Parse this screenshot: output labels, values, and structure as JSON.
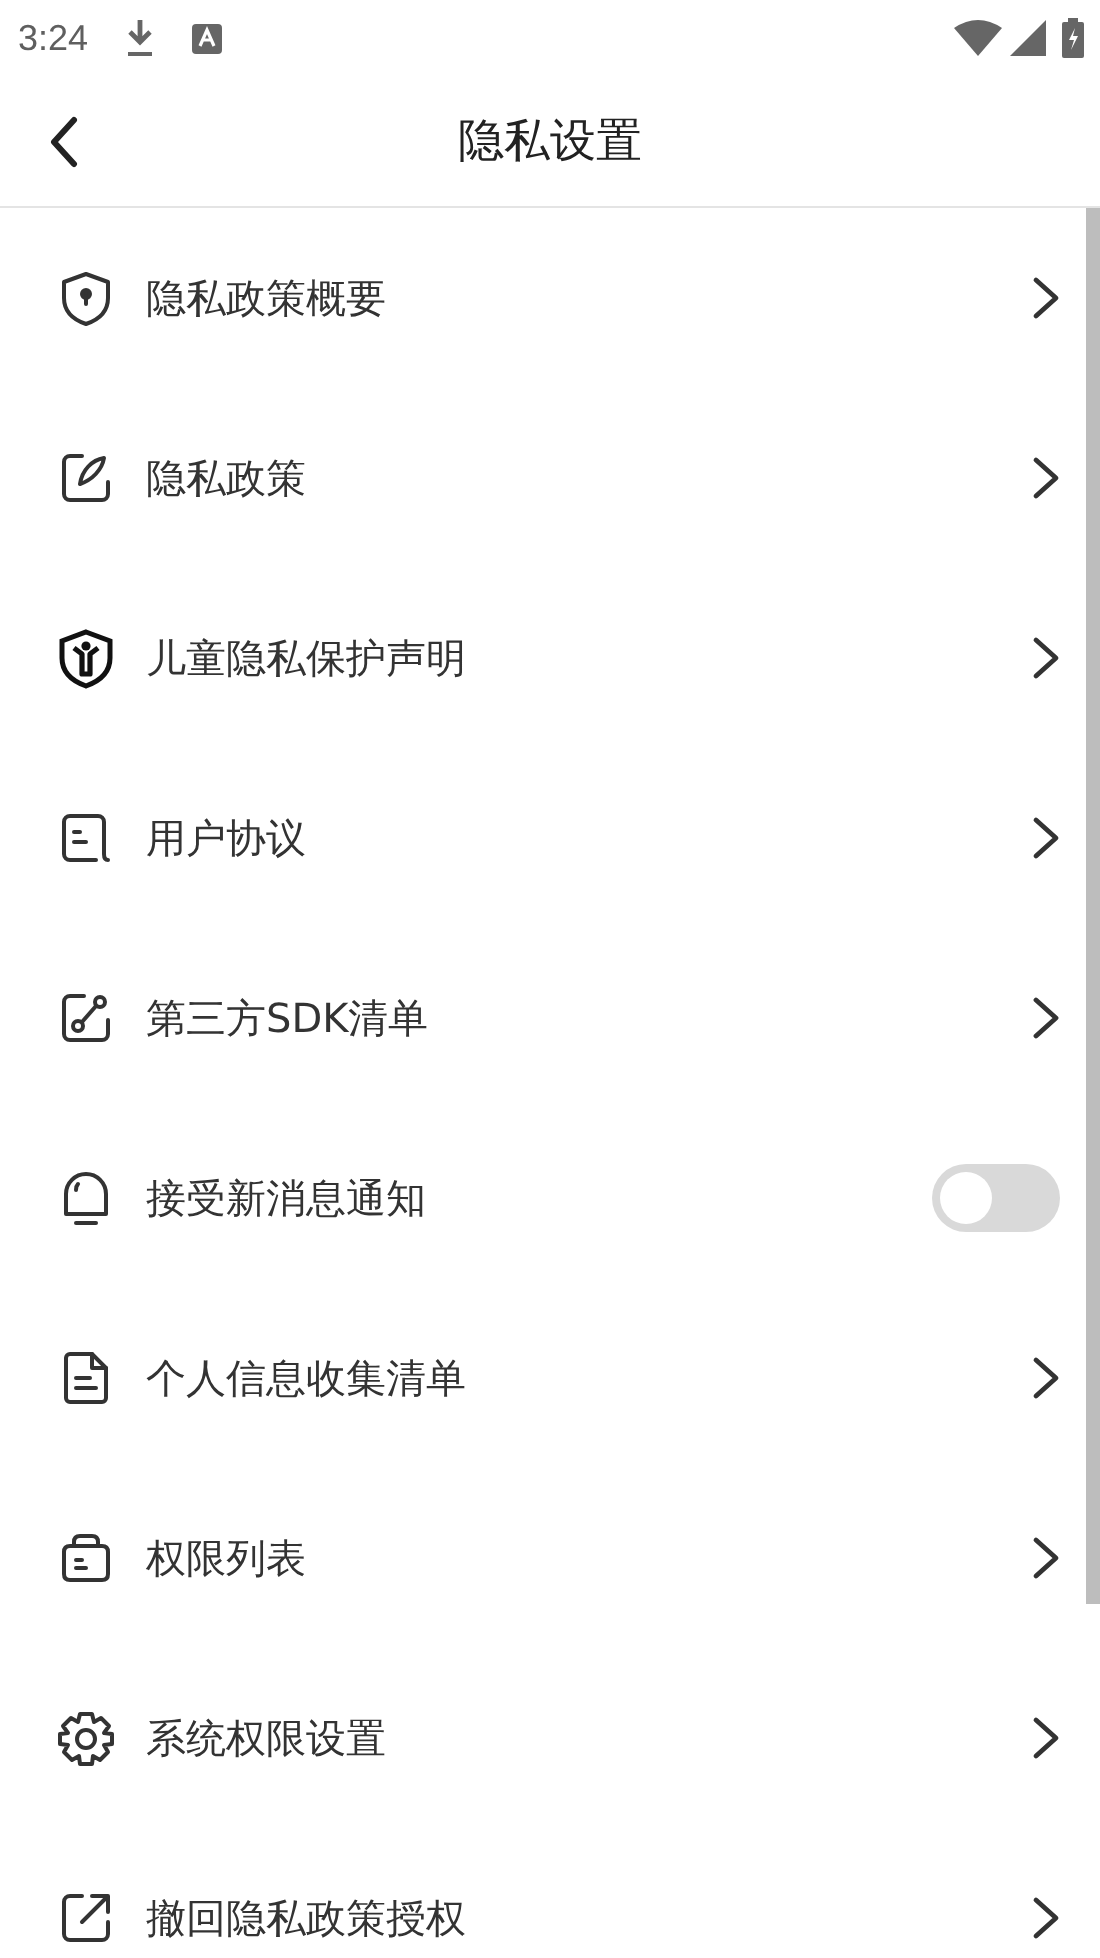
{
  "status_bar": {
    "time": "3:24"
  },
  "header": {
    "title": "隐私设置"
  },
  "items": [
    {
      "kind": "link",
      "label": "隐私政策概要"
    },
    {
      "kind": "link",
      "label": "隐私政策"
    },
    {
      "kind": "link",
      "label": "儿童隐私保护声明"
    },
    {
      "kind": "link",
      "label": "用户协议"
    },
    {
      "kind": "link",
      "label": "第三方SDK清单"
    },
    {
      "kind": "toggle",
      "label": "接受新消息通知",
      "on": false
    },
    {
      "kind": "link",
      "label": "个人信息收集清单"
    },
    {
      "kind": "link",
      "label": "权限列表"
    },
    {
      "kind": "link",
      "label": "系统权限设置"
    },
    {
      "kind": "link",
      "label": "撤回隐私政策授权"
    }
  ]
}
